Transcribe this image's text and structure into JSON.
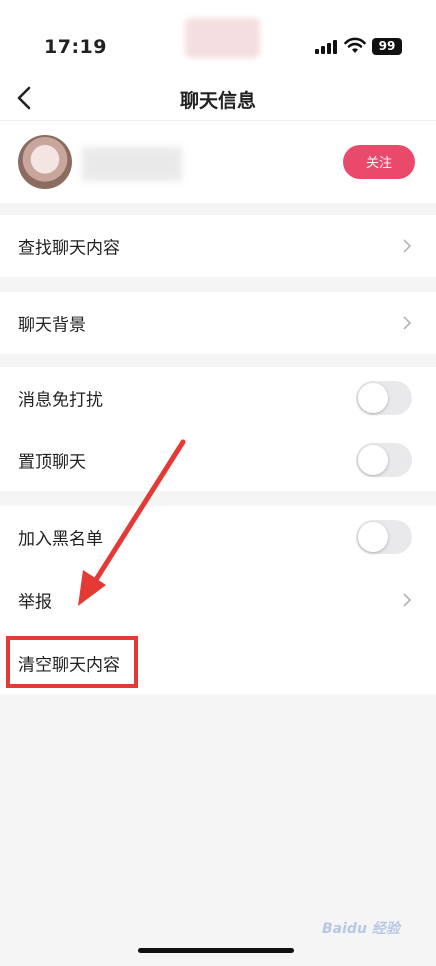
{
  "status_bar": {
    "time": "17:19",
    "battery": "99"
  },
  "navbar": {
    "title": "聊天信息"
  },
  "profile": {
    "follow_label": "关注"
  },
  "menu": {
    "find_chat": "查找聊天内容",
    "chat_background": "聊天背景",
    "mute": "消息免打扰",
    "mute_on": false,
    "pin_chat": "置顶聊天",
    "pin_on": false,
    "blacklist": "加入黑名单",
    "blacklist_on": false,
    "report": "举报",
    "clear_chat": "清空聊天内容"
  },
  "colors": {
    "accent": "#e94a6b",
    "highlight": "#e53935"
  },
  "watermark": "Baidu 经验"
}
